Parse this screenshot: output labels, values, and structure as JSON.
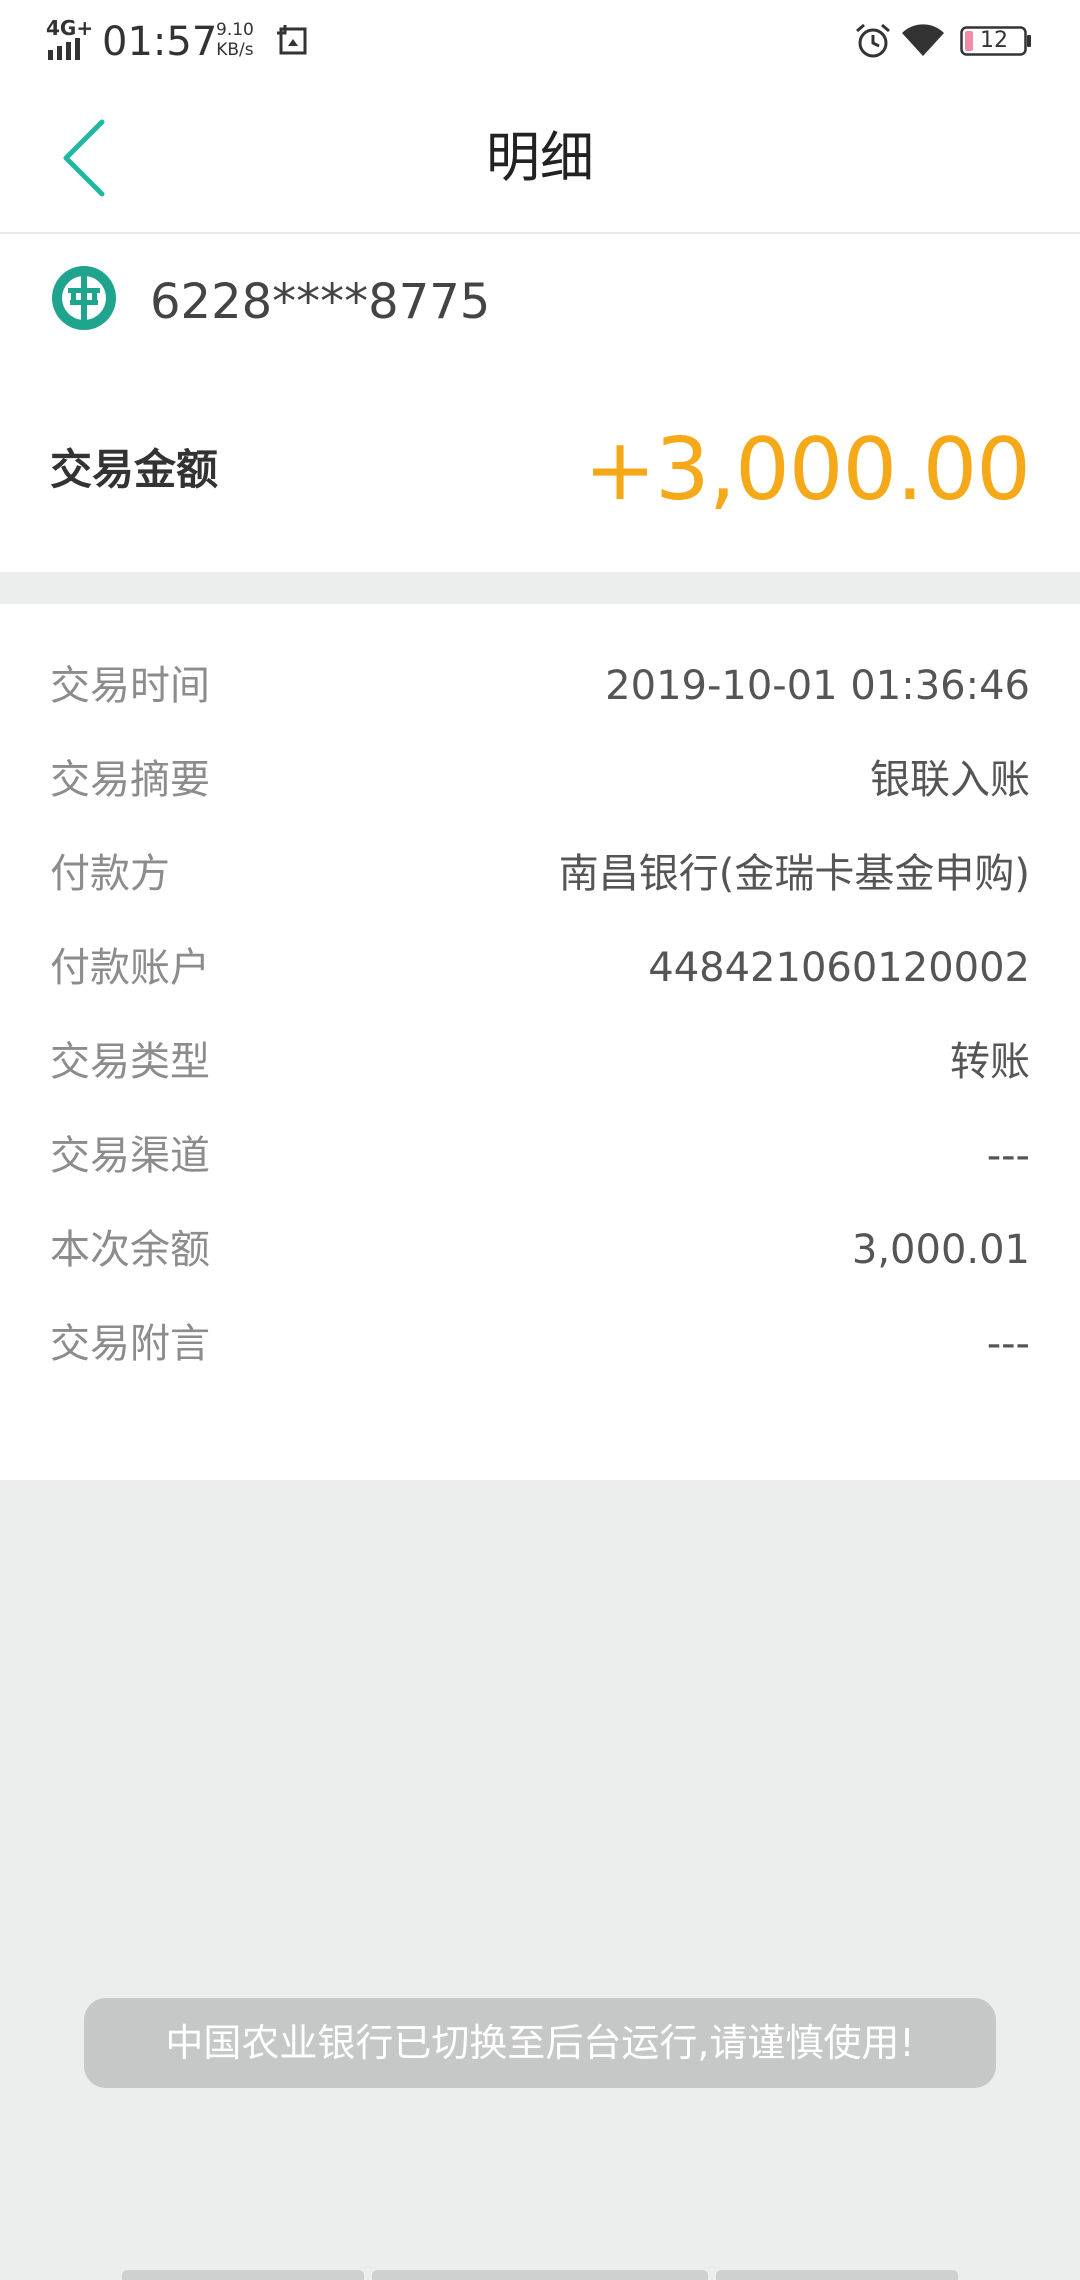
{
  "status_bar": {
    "network": "4G+",
    "time": "01:57",
    "speed_value": "9.10",
    "speed_unit": "KB/s",
    "battery": "12"
  },
  "nav": {
    "title": "明细",
    "back_icon": "chevron-left-icon"
  },
  "account": {
    "bank_icon": "abc-bank-logo-icon",
    "card_number": "6228****8775",
    "amount_label": "交易金额",
    "amount_value": "+3,000.00"
  },
  "details": [
    {
      "label": "交易时间",
      "value": "2019-10-01 01:36:46"
    },
    {
      "label": "交易摘要",
      "value": "银联入账"
    },
    {
      "label": "付款方",
      "value": "南昌银行(金瑞卡基金申购)"
    },
    {
      "label": "付款账户",
      "value": "448421060120002"
    },
    {
      "label": "交易类型",
      "value": "转账"
    },
    {
      "label": "交易渠道",
      "value": "---"
    },
    {
      "label": "本次余额",
      "value": "3,000.01"
    },
    {
      "label": "交易附言",
      "value": "---"
    }
  ],
  "toast": {
    "text": "中国农业银行已切换至后台运行,请谨慎使用!"
  },
  "colors": {
    "accent": "#1fb8a0",
    "amount": "#f5a818",
    "background": "#eceeee"
  }
}
